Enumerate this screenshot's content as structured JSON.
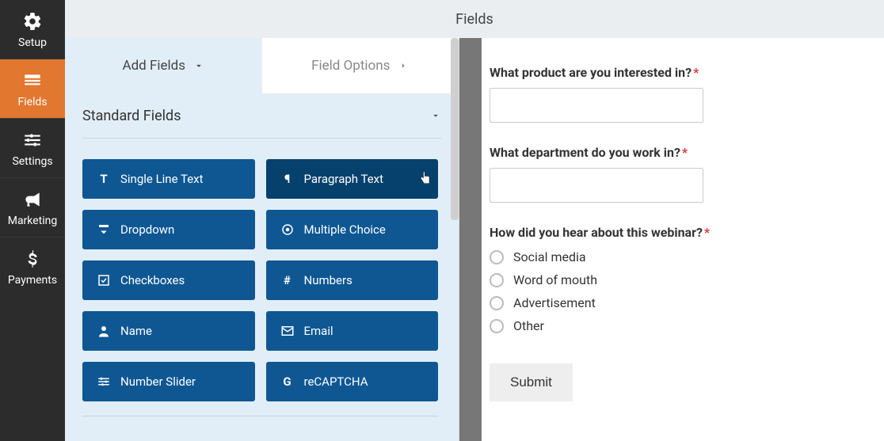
{
  "header": {
    "title": "Fields"
  },
  "sidebar": {
    "items": [
      {
        "label": "Setup"
      },
      {
        "label": "Fields"
      },
      {
        "label": "Settings"
      },
      {
        "label": "Marketing"
      },
      {
        "label": "Payments"
      }
    ]
  },
  "tabs": {
    "add_fields": "Add Fields",
    "field_options": "Field Options"
  },
  "section": {
    "standard": "Standard Fields"
  },
  "field_tiles": {
    "single_line_text": "Single Line Text",
    "paragraph_text": "Paragraph Text",
    "dropdown": "Dropdown",
    "multiple_choice": "Multiple Choice",
    "checkboxes": "Checkboxes",
    "numbers": "Numbers",
    "name": "Name",
    "email": "Email",
    "number_slider": "Number Slider",
    "recaptcha": "reCAPTCHA"
  },
  "preview": {
    "q1": {
      "label": "What product are you interested in?",
      "required": "*"
    },
    "q2": {
      "label": "What department do you work in?",
      "required": "*"
    },
    "q3": {
      "label": "How did you hear about this webinar?",
      "required": "*"
    },
    "q3_options": [
      "Social media",
      "Word of mouth",
      "Advertisement",
      "Other"
    ],
    "submit": "Submit"
  }
}
